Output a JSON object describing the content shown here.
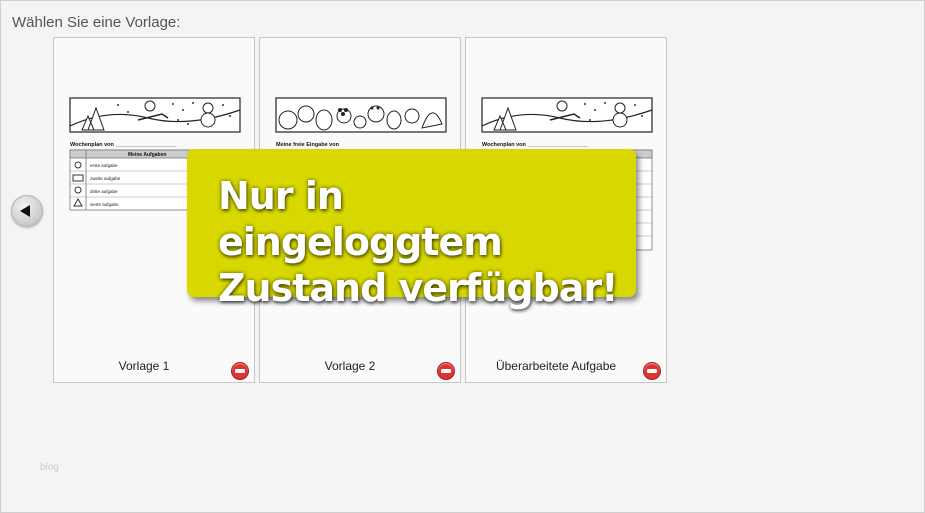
{
  "heading": "Wählen Sie eine Vorlage:",
  "templates": [
    {
      "label": "Vorlage 1",
      "thumb_title": "Wochenplan von ____________________",
      "table_header": "Meine Aufgaben",
      "rows": [
        "erste aufgabe",
        "zweite aufgabe",
        "dritte aufgabe",
        "vierte aufgabe"
      ]
    },
    {
      "label": "Vorlage 2",
      "thumb_title": "Meine freie Eingabe von"
    },
    {
      "label": "Überarbeitete Aufgabe",
      "thumb_title": "Wochenplan von ____________________"
    }
  ],
  "overlay": {
    "line1": "Nur in eingeloggtem",
    "line2": "Zustand verfügbar!"
  },
  "footer_link": "blog",
  "colors": {
    "overlay_bg": "#d8d800",
    "remove_icon": "#e03232",
    "page_bg": "#f4f4f4"
  }
}
